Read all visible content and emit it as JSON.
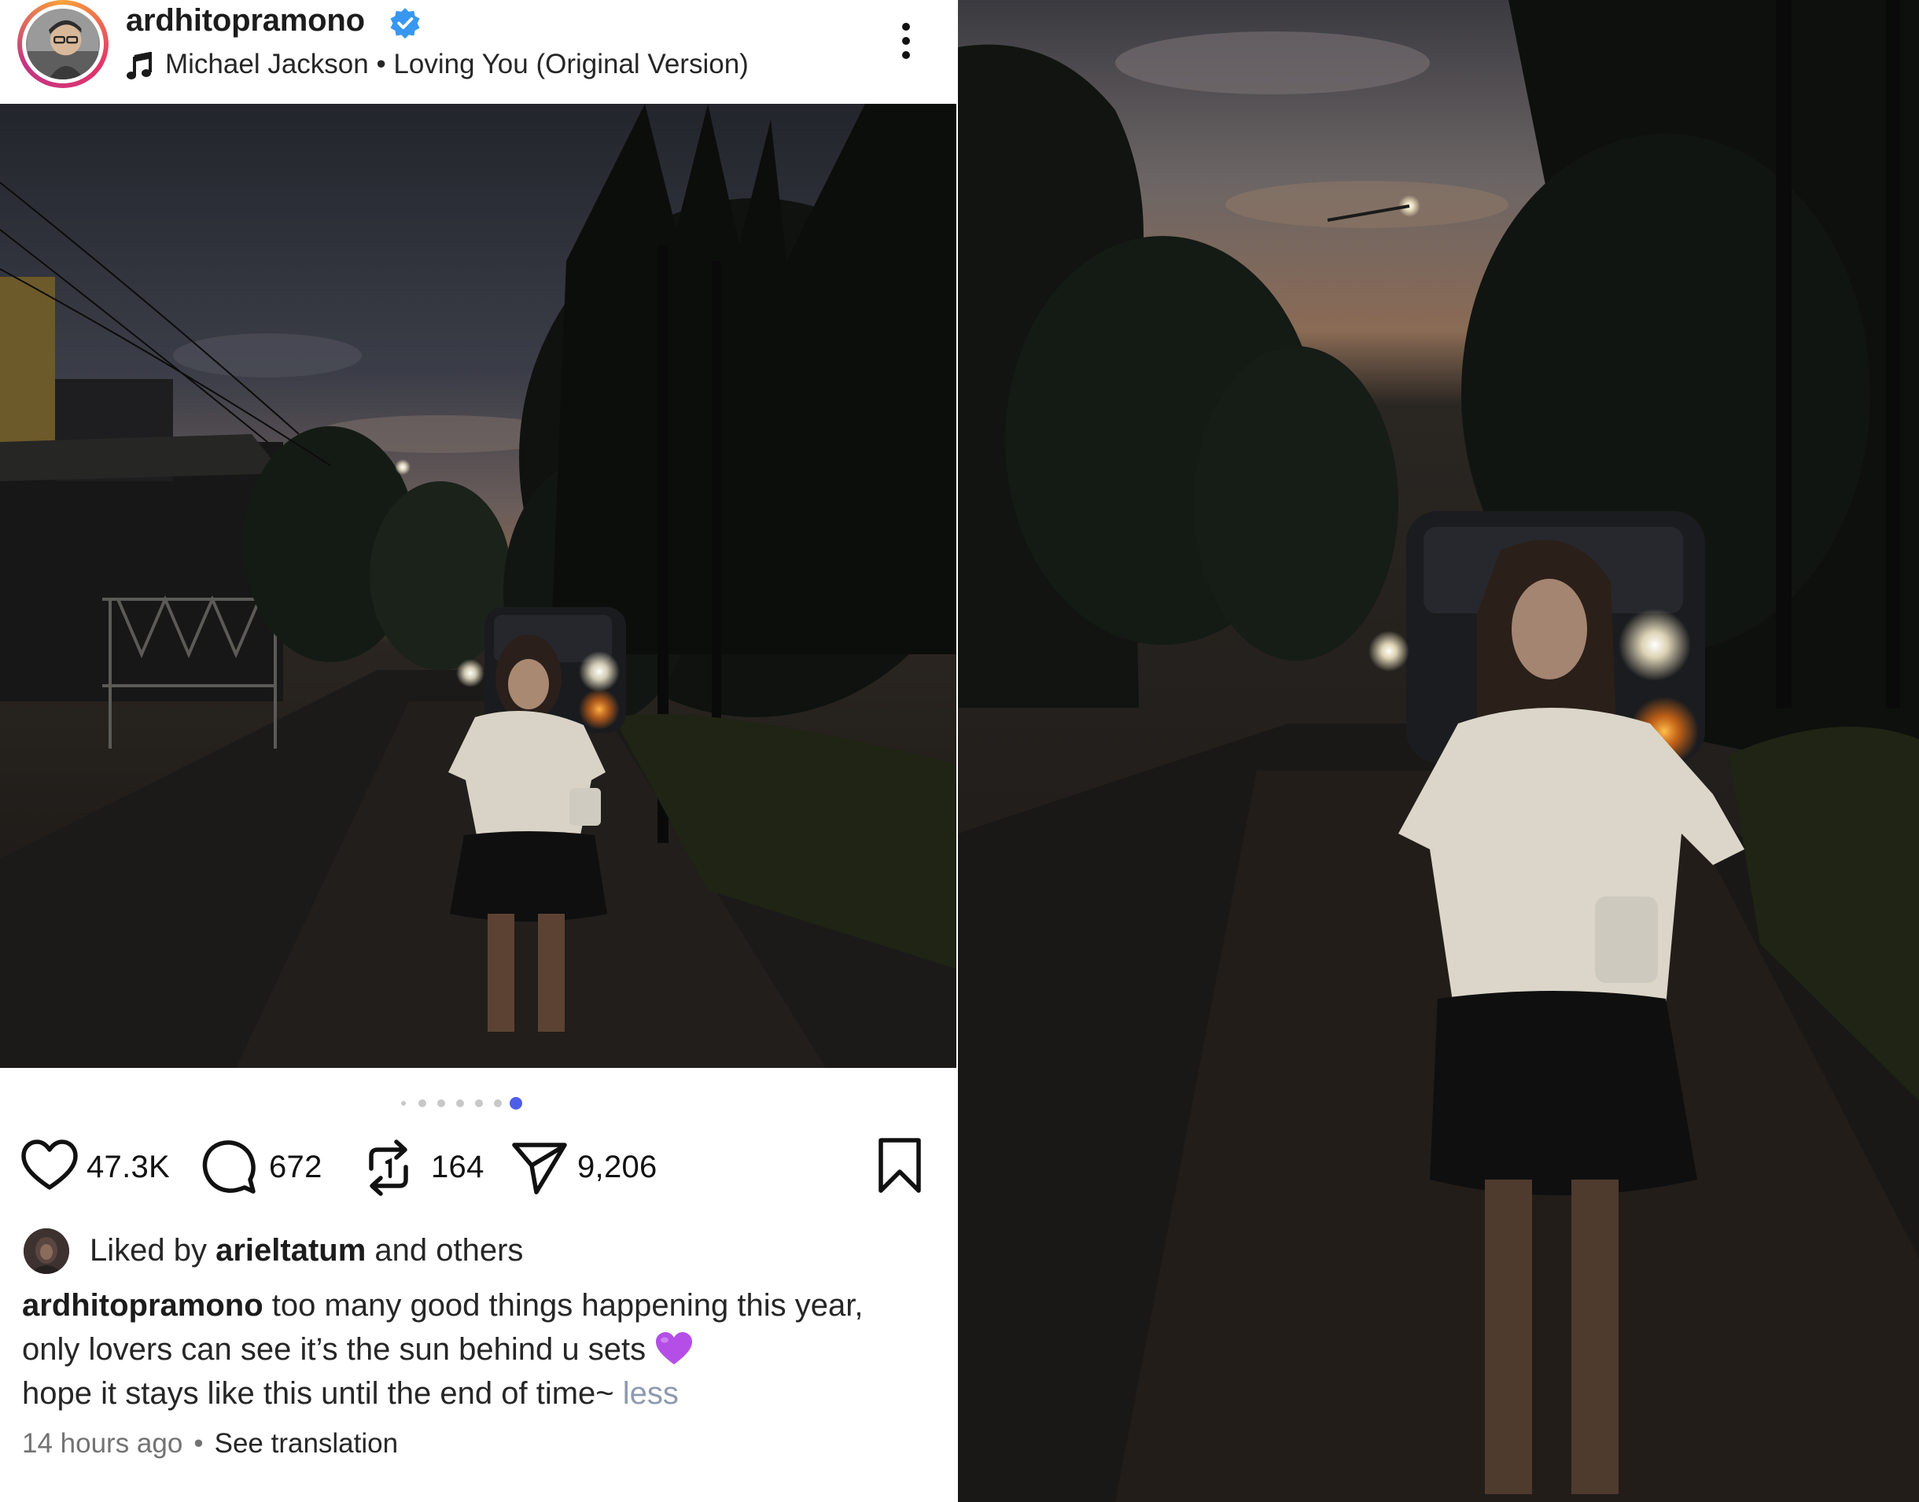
{
  "post": {
    "username": "ardhitopramono",
    "verified": true,
    "music": "Michael Jackson • Loving You (Original Version)",
    "icons": {
      "music": "music-note-icon",
      "more": "more-vertical-icon",
      "mute": "speaker-muted-icon",
      "like": "heart-icon",
      "comment": "comment-bubble-icon",
      "repost": "repost-icon",
      "share": "send-icon",
      "save": "bookmark-icon",
      "verified": "verified-badge-icon"
    },
    "carousel": {
      "total_dots": 7,
      "active_index": 6,
      "active_color": "#4f5ee8"
    },
    "counts": {
      "likes": "47.3K",
      "comments": "672",
      "reposts": "164",
      "shares": "9,206"
    },
    "liked_by": {
      "prefix": "Liked by",
      "user": "arieltatum",
      "suffix": "and others"
    },
    "caption": {
      "author": "ardhitopramono",
      "line1": "too many good things happening this year,",
      "line2": "only lovers can see it’s the sun behind u sets",
      "line3": "hope it stays like this until the end of time~",
      "less": "less"
    },
    "time_ago": "14 hours ago",
    "separator": "•",
    "see_translation": "See translation"
  },
  "colors": {
    "verified_blue": "#3897f0",
    "purple_heart": "#b54ee6",
    "less_link": "#8e9aaf",
    "muted_text": "#737373"
  }
}
